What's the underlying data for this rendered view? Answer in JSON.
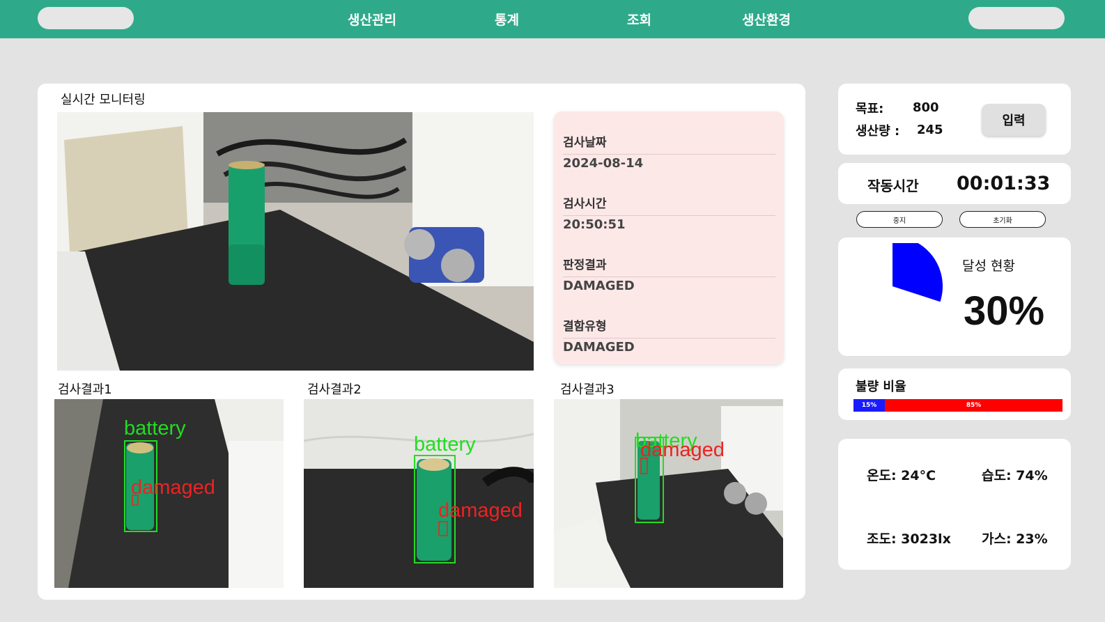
{
  "nav": {
    "items": [
      {
        "label": "생산관리"
      },
      {
        "label": "통계"
      },
      {
        "label": "조회"
      },
      {
        "label": "생산환경"
      }
    ]
  },
  "monitor": {
    "title": "실시간 모니터링",
    "results": [
      {
        "label": "검사결과1",
        "det_top": "battery",
        "det_bottom": "damaged"
      },
      {
        "label": "검사결과2",
        "det_top": "battery",
        "det_bottom": "damaged"
      },
      {
        "label": "검사결과3",
        "det_top": "battery",
        "det_bottom": "damaged"
      }
    ]
  },
  "inspection": {
    "date_label": "검사날짜",
    "date": "2024-08-14",
    "time_label": "검사시간",
    "time": "20:50:51",
    "verdict_label": "판정결과",
    "verdict": "DAMAGED",
    "defect_type_label": "결함유형",
    "defect_type": "DAMAGED"
  },
  "production": {
    "target_label": "목표:",
    "target": "800",
    "output_label": "생산량 :",
    "output": "245",
    "input_button": "입력"
  },
  "runtime": {
    "label": "작동시간",
    "value": "00:01:33",
    "stop_button": "중지",
    "reset_button": "초기화"
  },
  "achievement": {
    "label": "달성 현황",
    "percent_text": "30%",
    "fraction": 0.3,
    "color": "#0000ff"
  },
  "defect_ratio": {
    "label": "불량 비율",
    "good_pct_text": "15%",
    "bad_pct_text": "85%",
    "good_fraction": 0.15,
    "good_color": "#1a1aff",
    "bad_color": "#ff0000"
  },
  "environment": {
    "temperature": "온도: 24°C",
    "humidity": "습도: 74%",
    "illuminance": "조도: 3023lx",
    "gas": "가스: 23%"
  },
  "colors": {
    "nav_bg": "#2eaa8a",
    "detect_green": "#22dd22",
    "detect_red": "#ee2222"
  }
}
